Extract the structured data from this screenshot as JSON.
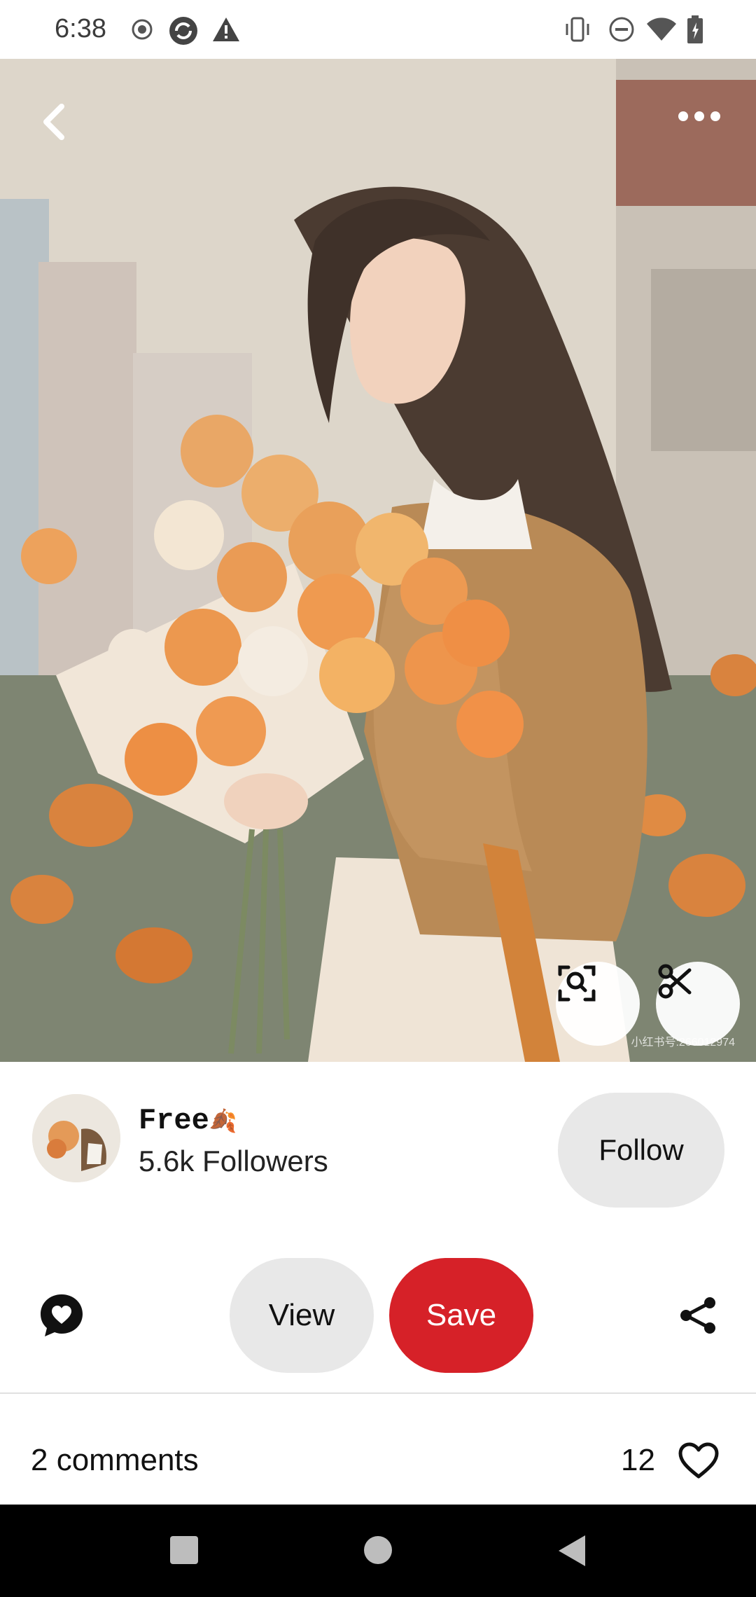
{
  "status_bar": {
    "time": "6:38",
    "icons_left": [
      "record-icon",
      "sync-icon",
      "alert-icon"
    ],
    "icons_right": [
      "vibrate-icon",
      "dnd-icon",
      "wifi-icon",
      "battery-icon"
    ]
  },
  "pin": {
    "image_description_icon": "anime-girl-with-orange-roses",
    "watermark": "小红书号:266012974",
    "top_actions": [
      "back-icon",
      "more-icon"
    ],
    "overlay_actions": [
      "visual-search-icon",
      "cutout-icon"
    ]
  },
  "creator": {
    "name": "Free",
    "name_emoji": "🍂",
    "followers": "5.6k Followers",
    "follow_label": "Follow"
  },
  "actions": {
    "comment_icon": "comment-heart-icon",
    "view_label": "View",
    "save_label": "Save",
    "share_icon": "share-icon"
  },
  "engagement": {
    "comments_label": "2 comments",
    "likes": "12"
  },
  "colors": {
    "save": "#d62128",
    "pill": "#e8e8e8",
    "nav_bar": "#000000"
  }
}
